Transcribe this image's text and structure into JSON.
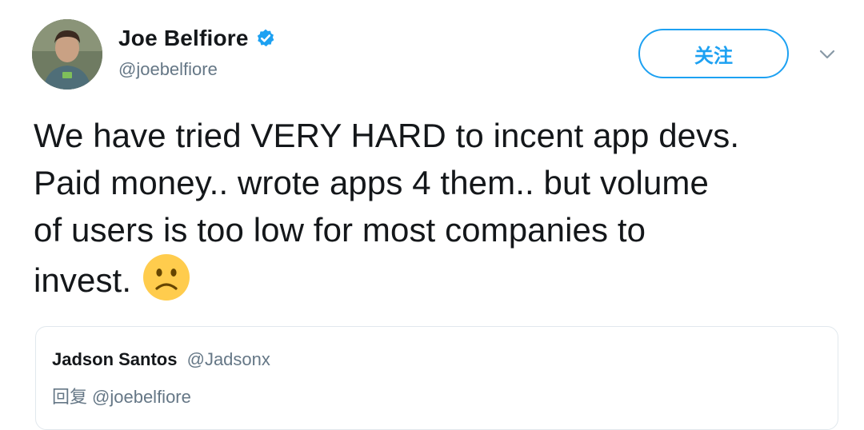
{
  "tweet": {
    "author": {
      "display_name": "Joe Belfiore",
      "handle": "@joebelfiore",
      "verified": true,
      "avatar_icon": "user-avatar"
    },
    "follow_label": "关注",
    "menu_icon": "chevron-down-icon",
    "text_lines": [
      "We have tried VERY HARD to incent app devs.",
      "Paid money.. wrote apps 4 them.. but volume",
      "of users is too low for most companies to",
      "invest."
    ],
    "emoji": "slightly-frowning-face",
    "quoted": {
      "display_name": "Jadson Santos",
      "handle": "@Jadsonx",
      "reply_prefix": "回复",
      "reply_to": "@joebelfiore"
    }
  },
  "colors": {
    "accent": "#1da1f2",
    "text": "#14171a",
    "muted": "#657786",
    "border": "#e1e8ed",
    "emoji": "#ffcc4d"
  }
}
